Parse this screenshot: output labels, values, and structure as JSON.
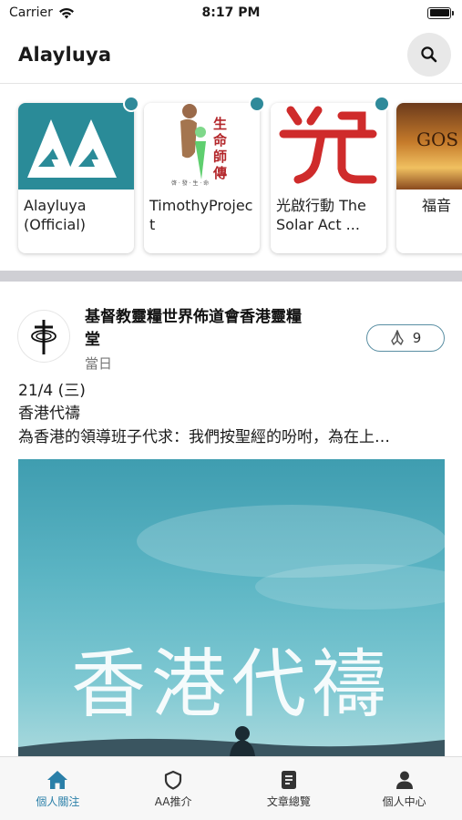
{
  "status_bar": {
    "carrier": "Carrier",
    "time": "8:17 PM"
  },
  "header": {
    "title": "Alayluya"
  },
  "channels": [
    {
      "label": "Alayluya (Official)",
      "has_update": true
    },
    {
      "label": "TimothyProject",
      "has_update": true
    },
    {
      "label": "光啟行動 The Solar Act ...",
      "has_update": true
    },
    {
      "label": "福音"
    }
  ],
  "channel_art": {
    "timothy_logo_text": "生命 師傳",
    "timothy_logo_subtext": "啓 · 發 · 生 · 命",
    "gospel_cover_text": "GOS"
  },
  "post": {
    "author": "基督教靈糧世界佈道會香港靈糧堂",
    "time": "當日",
    "pray_count": "9",
    "date": "21/4 (三)",
    "subtitle": "香港代禱",
    "excerpt": "為香港的領導班子代求：我們按聖經的吩咐，為在上…",
    "image_text": "香港代禱"
  },
  "tabs": [
    {
      "label": "個人關注",
      "icon": "home-icon",
      "active": true
    },
    {
      "label": "AA推介",
      "icon": "shield-icon"
    },
    {
      "label": "文章總覽",
      "icon": "document-icon"
    },
    {
      "label": "個人中心",
      "icon": "person-icon"
    }
  ],
  "colors": {
    "accent": "#2f8a9a",
    "tab_active": "#2a7fa8",
    "divider": "#cfcfd4"
  }
}
